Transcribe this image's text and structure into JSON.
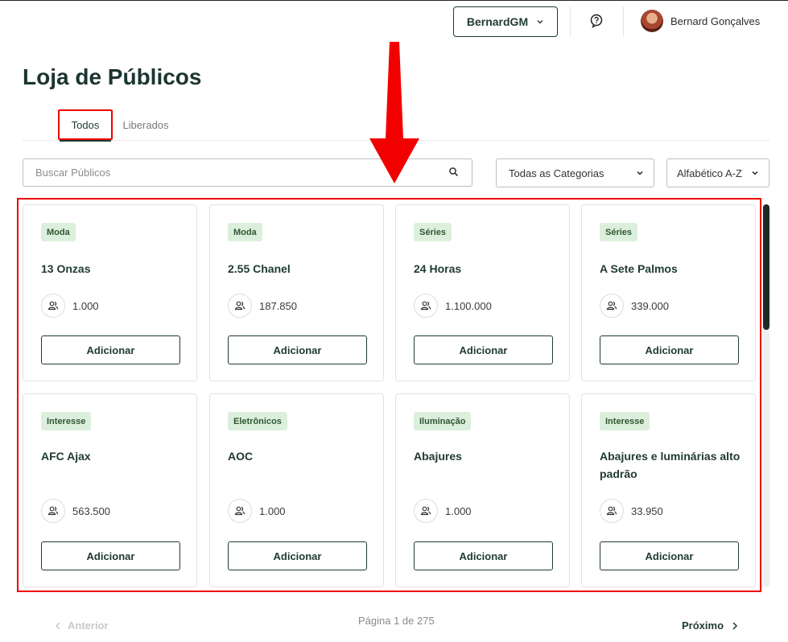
{
  "header": {
    "account_label": "BernardGM",
    "user_name": "Bernard Gonçalves"
  },
  "page": {
    "title": "Loja de Públicos"
  },
  "tabs": [
    {
      "label": "Todos",
      "active": true
    },
    {
      "label": "Liberados",
      "active": false
    }
  ],
  "filters": {
    "search_placeholder": "Buscar Públicos",
    "category": "Todas as Categorias",
    "sort": "Alfabético A-Z"
  },
  "cards": [
    {
      "category": "Moda",
      "name": "13 Onzas",
      "count": "1.000",
      "button": "Adicionar"
    },
    {
      "category": "Moda",
      "name": "2.55 Chanel",
      "count": "187.850",
      "button": "Adicionar"
    },
    {
      "category": "Séries",
      "name": "24 Horas",
      "count": "1.100.000",
      "button": "Adicionar"
    },
    {
      "category": "Séries",
      "name": "A Sete Palmos",
      "count": "339.000",
      "button": "Adicionar"
    },
    {
      "category": "Interesse",
      "name": "AFC Ajax",
      "count": "563.500",
      "button": "Adicionar"
    },
    {
      "category": "Eletrônicos",
      "name": "AOC",
      "count": "1.000",
      "button": "Adicionar"
    },
    {
      "category": "Iluminação",
      "name": "Abajures",
      "count": "1.000",
      "button": "Adicionar"
    },
    {
      "category": "Interesse",
      "name": "Abajures e luminárias alto padrão",
      "count": "33.950",
      "button": "Adicionar"
    }
  ],
  "pagination": {
    "prev": "Anterior",
    "info": "Página 1 de 275",
    "next": "Próximo"
  },
  "colors": {
    "primary": "#1f3a33",
    "badge_bg": "#dcefdc",
    "annotation": "#e00000"
  }
}
